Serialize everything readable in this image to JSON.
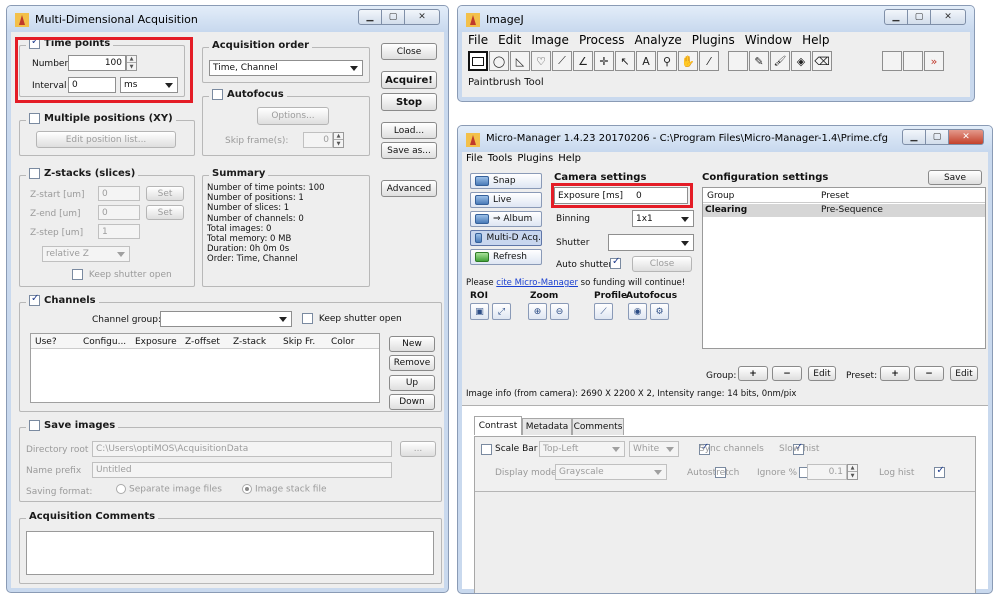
{
  "mda": {
    "title": "Multi-Dimensional Acquisition",
    "time_points": {
      "label": "Time points",
      "number_label": "Number",
      "number_value": "100",
      "interval_label": "Interval",
      "interval_value": "0",
      "interval_unit": "ms"
    },
    "acq_order": {
      "label": "Acquisition order",
      "value": "Time, Channel"
    },
    "autofocus": {
      "label": "Autofocus",
      "options_label": "Options...",
      "skip_label": "Skip frame(s):",
      "skip_value": "0"
    },
    "buttons": {
      "close": "Close",
      "acquire": "Acquire!",
      "stop": "Stop",
      "load": "Load...",
      "save_as": "Save as...",
      "advanced": "Advanced"
    },
    "positions": {
      "label": "Multiple positions (XY)",
      "edit_button": "Edit position list..."
    },
    "zstacks": {
      "label": "Z-stacks (slices)",
      "zstart_label": "Z-start [um]",
      "zstart_value": "0",
      "zend_label": "Z-end [um]",
      "zend_value": "0",
      "zstep_label": "Z-step [um]",
      "zstep_value": "1",
      "set": "Set",
      "mode": "relative Z",
      "keep_shutter": "Keep shutter open"
    },
    "summary": {
      "label": "Summary",
      "lines": [
        "Number of time points: 100",
        "Number of positions: 1",
        "Number of slices: 1",
        "Number of channels: 0",
        "Total images: 0",
        "Total memory: 0 MB",
        "Duration: 0h 0m 0s",
        "Order: Time, Channel"
      ]
    },
    "channels": {
      "label": "Channels",
      "group_label": "Channel group:",
      "keep_shutter": "Keep shutter open",
      "columns": [
        "Use?",
        "Configu...",
        "Exposure",
        "Z-offset",
        "Z-stack",
        "Skip Fr.",
        "Color"
      ],
      "buttons": {
        "new": "New",
        "remove": "Remove",
        "up": "Up",
        "down": "Down"
      }
    },
    "save": {
      "label": "Save images",
      "dir_label": "Directory root",
      "dir_value": "C:\\Users\\optiMOS\\AcquisitionData",
      "dir_btn": "...",
      "prefix_label": "Name prefix",
      "prefix_value": "Untitled",
      "format_label": "Saving format:",
      "separate": "Separate image files",
      "stack": "Image stack file"
    },
    "comments_label": "Acquisition Comments"
  },
  "imagej": {
    "title": "ImageJ",
    "menus": [
      "File",
      "Edit",
      "Image",
      "Process",
      "Analyze",
      "Plugins",
      "Window",
      "Help"
    ],
    "tools": [
      "rectangle-tool",
      "oval-tool",
      "polygon-tool",
      "freehand-tool",
      "line-tool",
      "angle-tool",
      "point-tool",
      "wand-tool",
      "text-tool",
      "magnifier-tool",
      "scroll-tool",
      "color-picker-tool",
      "pencil-tool",
      "paintbrush-tool",
      "flood-fill-tool",
      "eraser-tool",
      "more-tools"
    ],
    "tool_glyphs": [
      "",
      "◯",
      "◺",
      "♡",
      "⟋",
      "∠",
      "✛",
      "↖",
      "A",
      "⚲",
      "✋",
      "⁄",
      "✎",
      "🖌",
      "◈",
      "⌫",
      "»"
    ],
    "status": "Paintbrush Tool"
  },
  "mm": {
    "title": "Micro-Manager 1.4.23 20170206 - C:\\Program Files\\Micro-Manager-1.4\\Prime.cfg",
    "menus": [
      "File",
      "Tools",
      "Plugins",
      "Help"
    ],
    "buttons": {
      "snap": "Snap",
      "live": "Live",
      "album": "⇒ Album",
      "mda": "Multi-D Acq.",
      "refresh": "Refresh"
    },
    "camera": {
      "label": "Camera settings",
      "exposure_label": "Exposure [ms]",
      "exposure_value": "0",
      "binning_label": "Binning",
      "binning_value": "1x1",
      "shutter_label": "Shutter",
      "auto_shutter": "Auto shutter",
      "close": "Close"
    },
    "cite_prefix": "Please ",
    "cite_link": "cite Micro-Manager",
    "cite_suffix": " so funding will continue!",
    "roi": "ROI",
    "zoom": "Zoom",
    "profile": "Profile",
    "autofocus": "Autofocus",
    "config": {
      "label": "Configuration settings",
      "save": "Save",
      "col_group": "Group",
      "col_preset": "Preset",
      "rows": [
        {
          "group": "Clearing",
          "preset": "Pre-Sequence"
        }
      ],
      "group_label": "Group:",
      "preset_label": "Preset:",
      "plus": "+",
      "minus": "−",
      "edit": "Edit"
    },
    "image_info": "Image info (from camera): 2690 X 2200 X 2, Intensity range: 14 bits, 0nm/pix",
    "tabs": [
      "Contrast",
      "Metadata",
      "Comments"
    ],
    "contrast": {
      "scale_bar": "Scale Bar",
      "position": "Top-Left",
      "color": "White",
      "sync": "Sync channels",
      "slow": "Slow hist",
      "display_mode_label": "Display mode:",
      "display_mode": "Grayscale",
      "autostretch": "Autostretch",
      "ignore": "Ignore %",
      "ignore_value": "0.1",
      "log": "Log hist"
    }
  }
}
